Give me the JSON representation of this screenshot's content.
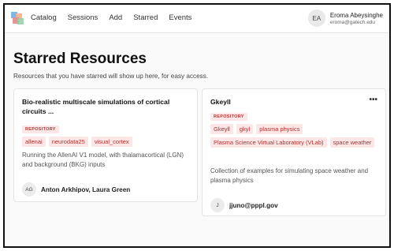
{
  "nav": {
    "items": [
      "Catalog",
      "Sessions",
      "Add",
      "Starred",
      "Events"
    ],
    "logo_colors": [
      "#7fb8e6",
      "#f2b08b",
      "#e58a8a",
      "#8fd1a4"
    ]
  },
  "user": {
    "initials": "EA",
    "name": "Eroma Abeysinghe",
    "email": "eroma@gatech.edu"
  },
  "page": {
    "title": "Starred Resources",
    "subtitle": "Resources that you have starred will show up here, for easy access."
  },
  "cards": [
    {
      "title": "Bio-realistic multiscale simulations of cortical circuits ...",
      "badge": "REPOSITORY",
      "tags": [
        "allenai",
        "neurodata25",
        "visual_cortex"
      ],
      "description": "Running the AllenAI V1 model, with thalamacortical (LGN) and background (BKG) inputs",
      "author_initials": "AG",
      "author": "Anton Arkhipov, Laura Green"
    },
    {
      "title": "Gkeyll",
      "menu": "•••",
      "badge": "REPOSITORY",
      "tags": [
        "Gkeyll",
        "gkyl",
        "plasma physics",
        "Plasma Science Virtual Laboratory (VLab)",
        "space weather"
      ],
      "description": "Collection of examples for simulating space weather and plasma physics",
      "author_initials": "J",
      "author": "jjuno@pppl.gov"
    }
  ],
  "colors": {
    "tag_bg": "#fde6e6",
    "tag_text": "#a33333"
  }
}
